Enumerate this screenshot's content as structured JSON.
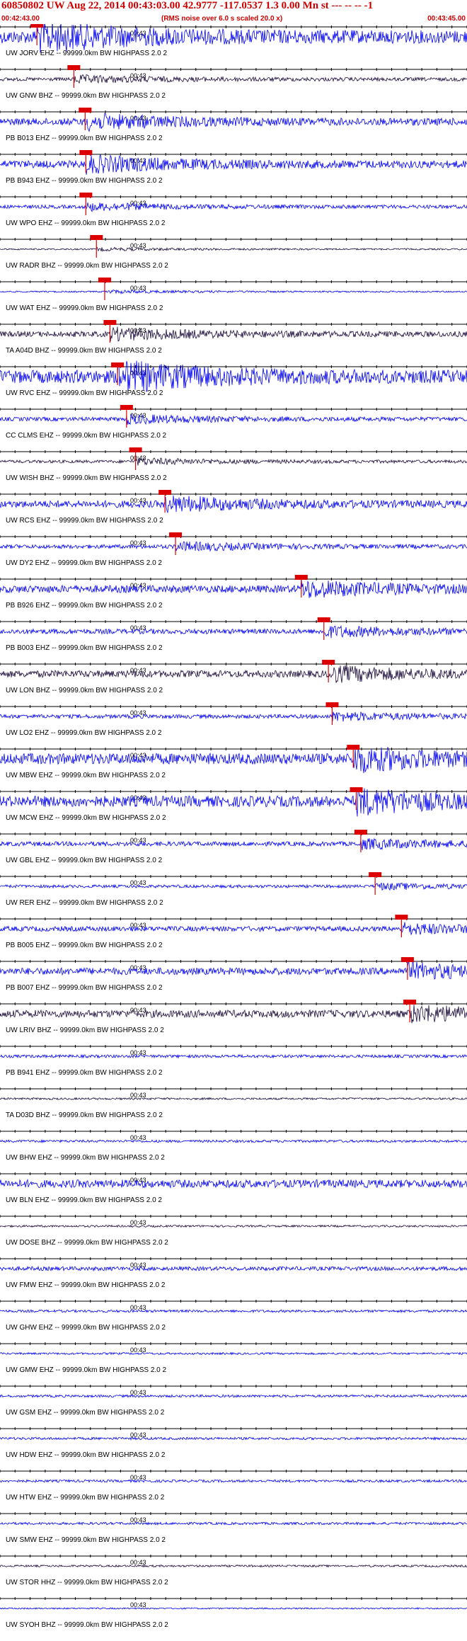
{
  "header": {
    "title": "60850802 UW Aug 22, 2014 00:43:03.00   42.9777 -117.0537  1.3 0.00 Mn st --- -- --  -1",
    "start_time": "00:42:43.00",
    "noise_note": "(RMS noise over 6.0 s scaled 20.0 x)",
    "end_time": "00:43:45.00"
  },
  "colors": {
    "header_text": "#cc0000",
    "trace_blue": "#0000ee",
    "trace_dark": "#1a0a3a",
    "pick": "#dd0000",
    "axis": "#000000",
    "background": "#ffffff"
  },
  "chart_data": {
    "type": "line",
    "title": "60850802 UW Aug 22, 2014 00:43:03.00   42.9777 -117.0537  1.3 0.00 Mn st --- -- --  -1",
    "x_range": [
      "00:42:43.00",
      "00:43:45.00"
    ],
    "tick_label": "00:43",
    "grid": false,
    "channel_suffix": "-- 99999.0km BW  HIGHPASS  2.0  2",
    "series": [
      {
        "name": "UW JORV EHZ",
        "pick_s": 4.9,
        "envelope": 26,
        "color": "blue"
      },
      {
        "name": "UW GNW BHZ",
        "pick_s": 9.8,
        "envelope": 7,
        "color": "dark"
      },
      {
        "name": "PB B013 EHZ",
        "pick_s": 11.3,
        "envelope": 14,
        "color": "blue"
      },
      {
        "name": "PB B943 EHZ",
        "pick_s": 11.4,
        "envelope": 15,
        "color": "blue"
      },
      {
        "name": "UW WPO EHZ",
        "pick_s": 11.4,
        "envelope": 7,
        "color": "blue"
      },
      {
        "name": "UW RADR BHZ",
        "pick_s": 12.8,
        "envelope": 3,
        "color": "dark"
      },
      {
        "name": "UW WAT EHZ",
        "pick_s": 13.9,
        "envelope": 3,
        "color": "blue"
      },
      {
        "name": "TA A04D BHZ",
        "pick_s": 14.6,
        "envelope": 11,
        "color": "dark"
      },
      {
        "name": "UW RVC EHZ",
        "pick_s": 15.6,
        "envelope": 26,
        "color": "blue"
      },
      {
        "name": "CC CLMS EHZ",
        "pick_s": 16.8,
        "envelope": 8,
        "color": "blue"
      },
      {
        "name": "UW WISH BHZ",
        "pick_s": 18.0,
        "envelope": 6,
        "color": "dark"
      },
      {
        "name": "UW RCS EHZ",
        "pick_s": 21.9,
        "envelope": 14,
        "color": "blue"
      },
      {
        "name": "UW DY2 EHZ",
        "pick_s": 23.3,
        "envelope": 8,
        "color": "blue"
      },
      {
        "name": "PB B926 EHZ",
        "pick_s": 40.0,
        "envelope": 15,
        "color": "blue"
      },
      {
        "name": "PB B003 EHZ",
        "pick_s": 43.0,
        "envelope": 10,
        "color": "blue"
      },
      {
        "name": "UW LON BHZ",
        "pick_s": 43.6,
        "envelope": 14,
        "color": "dark"
      },
      {
        "name": "UW LO2 EHZ",
        "pick_s": 44.1,
        "envelope": 8,
        "color": "blue"
      },
      {
        "name": "UW MBW EHZ",
        "pick_s": 46.9,
        "envelope": 22,
        "color": "blue"
      },
      {
        "name": "UW MCW EHZ",
        "pick_s": 47.3,
        "envelope": 22,
        "color": "blue"
      },
      {
        "name": "UW GBL EHZ",
        "pick_s": 47.9,
        "envelope": 9,
        "color": "blue"
      },
      {
        "name": "UW RER EHZ",
        "pick_s": 49.8,
        "envelope": 6,
        "color": "blue"
      },
      {
        "name": "PB B005 EHZ",
        "pick_s": 53.3,
        "envelope": 10,
        "color": "blue"
      },
      {
        "name": "PB B007 EHZ",
        "pick_s": 54.1,
        "envelope": 14,
        "color": "blue"
      },
      {
        "name": "UW LRIV BHZ",
        "pick_s": 54.4,
        "envelope": 15,
        "color": "dark"
      },
      {
        "name": "PB B941 EHZ",
        "pick_s": null,
        "envelope": 6,
        "color": "blue"
      },
      {
        "name": "TA D03D BHZ",
        "pick_s": null,
        "envelope": 4,
        "color": "dark"
      },
      {
        "name": "UW BHW EHZ",
        "pick_s": null,
        "envelope": 5,
        "color": "blue"
      },
      {
        "name": "UW BLN EHZ",
        "pick_s": null,
        "envelope": 16,
        "color": "blue"
      },
      {
        "name": "UW DOSE BHZ",
        "pick_s": null,
        "envelope": 4,
        "color": "dark"
      },
      {
        "name": "UW FMW EHZ",
        "pick_s": null,
        "envelope": 8,
        "color": "blue"
      },
      {
        "name": "UW GHW EHZ",
        "pick_s": null,
        "envelope": 5,
        "color": "blue"
      },
      {
        "name": "UW GMW EHZ",
        "pick_s": null,
        "envelope": 4,
        "color": "blue"
      },
      {
        "name": "UW GSM EHZ",
        "pick_s": null,
        "envelope": 5,
        "color": "blue"
      },
      {
        "name": "UW HDW EHZ",
        "pick_s": null,
        "envelope": 5,
        "color": "blue"
      },
      {
        "name": "UW HTW EHZ",
        "pick_s": null,
        "envelope": 5,
        "color": "blue"
      },
      {
        "name": "UW SMW EHZ",
        "pick_s": null,
        "envelope": 5,
        "color": "blue"
      },
      {
        "name": "UW STOR HHZ",
        "pick_s": null,
        "envelope": 4,
        "color": "dark"
      },
      {
        "name": "UW SYOH BHZ",
        "pick_s": null,
        "envelope": 3,
        "color": "blue"
      }
    ]
  }
}
